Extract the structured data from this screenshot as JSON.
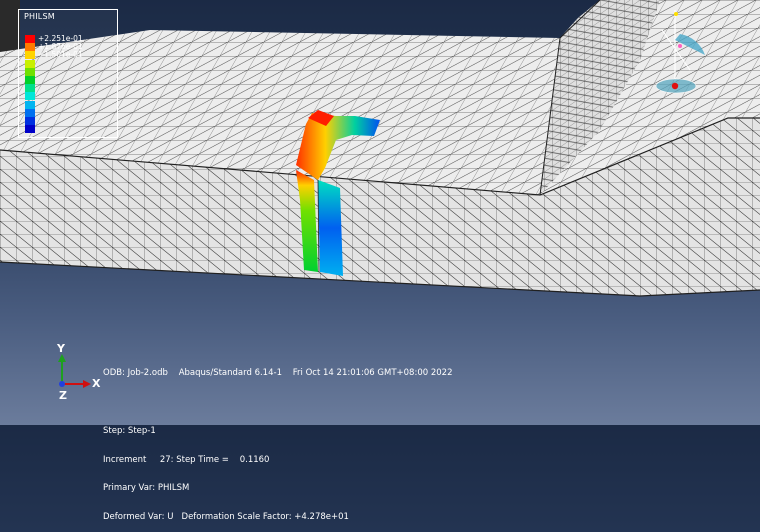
{
  "legend": {
    "title": "PHILSM",
    "entries": [
      {
        "value": "+2.251e-01",
        "color": "#ff0000"
      },
      {
        "value": "+1.876e-01",
        "color": "#ff7a00"
      },
      {
        "value": "+1.501e-01",
        "color": "#ffd400"
      },
      {
        "value": "",
        "color": "#c8f000"
      },
      {
        "value": "",
        "color": "#6fe000"
      },
      {
        "value": "",
        "color": "#00d028"
      },
      {
        "value": "",
        "color": "#00e08a"
      },
      {
        "value": "",
        "color": "#00e6d8"
      },
      {
        "value": "",
        "color": "#00b4f0"
      },
      {
        "value": "",
        "color": "#0070f0"
      },
      {
        "value": "",
        "color": "#0030e0"
      },
      {
        "value": "",
        "color": "#0000c8"
      }
    ]
  },
  "info": {
    "odb_line": "ODB: Job-2.odb    Abaqus/Standard 6.14-1    Fri Oct 14 21:01:06 GMT+08:00 2022",
    "step_line": "Step: Step-1",
    "increment_line": "Increment     27: Step Time =    0.1160",
    "primary_var_line": "Primary Var: PHILSM",
    "deformed_var_line": "Deformed Var: U   Deformation Scale Factor: +4.278e+01"
  },
  "triad": {
    "x_label": "X",
    "y_label": "Y",
    "z_label": "Z"
  },
  "colors": {
    "mesh_face": "#ececec",
    "mesh_line": "#3a3a3a",
    "background_top": "#1b2a45"
  }
}
